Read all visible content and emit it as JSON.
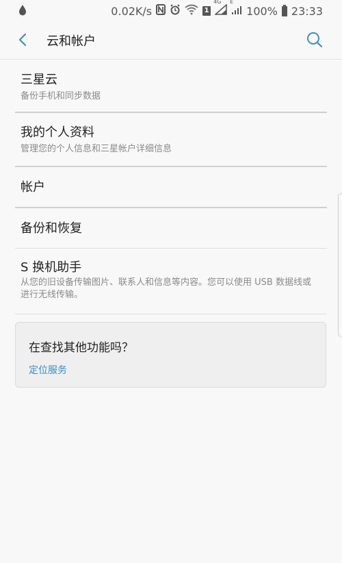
{
  "status_bar": {
    "speed": "0.02K/s",
    "network_tag": "4G",
    "edge_tag": "E",
    "battery": "100%",
    "time": "23:33",
    "sim_number": "1"
  },
  "header": {
    "title": "云和帐户"
  },
  "items": [
    {
      "title": "三星云",
      "subtitle": "备份手机和同步数据"
    },
    {
      "title": "我的个人资料",
      "subtitle": "管理您的个人信息和三星帐户详细信息"
    },
    {
      "title": "帐户",
      "subtitle": ""
    },
    {
      "title": "备份和恢复",
      "subtitle": ""
    },
    {
      "title": "S 换机助手",
      "subtitle": "从您的旧设备传输图片、联系人和信息等内容。您可以使用 USB 数据线或进行无线传输。"
    }
  ],
  "card": {
    "question": "在查找其他功能吗？",
    "link": "定位服务"
  },
  "colors": {
    "accent": "#3b8fc1",
    "background": "#f8f8f8"
  }
}
